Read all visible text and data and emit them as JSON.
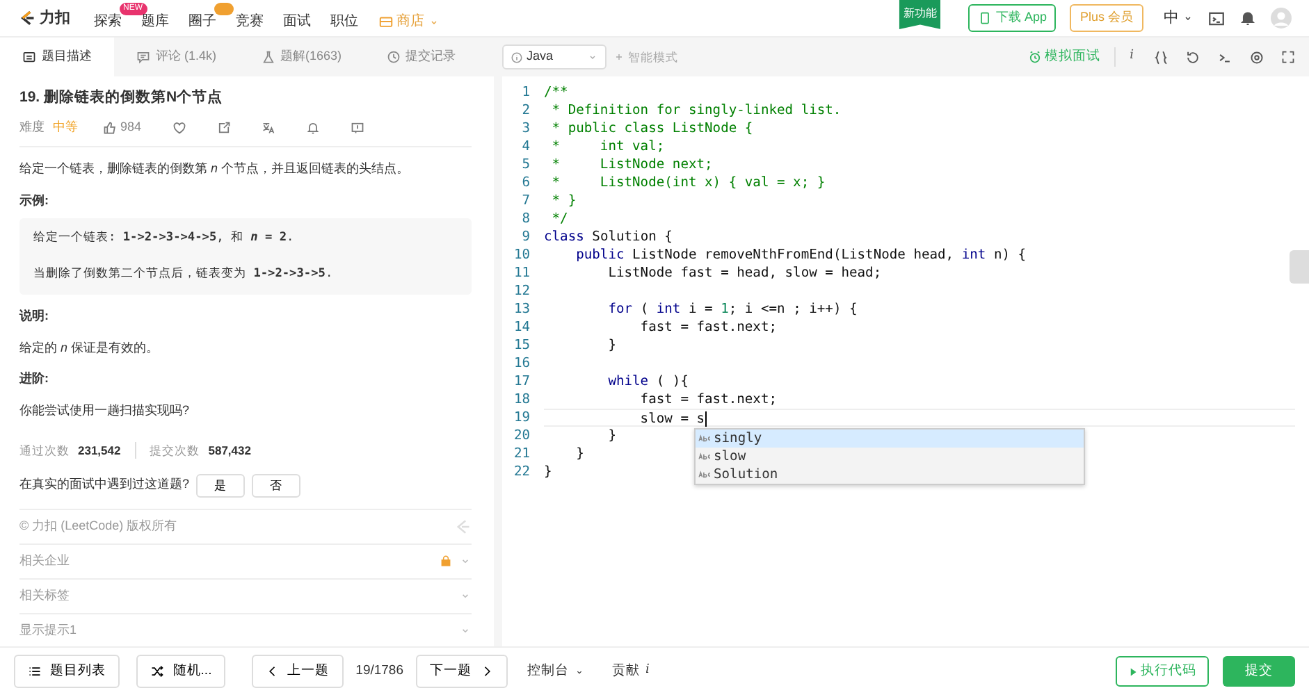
{
  "topnav": {
    "logo": "力扣",
    "items": [
      {
        "label": "探索",
        "kind": "link",
        "badge": {
          "text": "NEW",
          "color": "#e8336d"
        }
      },
      {
        "label": "题库",
        "kind": "link"
      },
      {
        "label": "圈子",
        "kind": "link",
        "badge": {
          "color": "#f0a030"
        }
      },
      {
        "label": "竞赛",
        "kind": "link"
      },
      {
        "label": "面试",
        "kind": "link"
      },
      {
        "label": "职位",
        "kind": "link"
      },
      {
        "label": "商店",
        "kind": "shop"
      }
    ],
    "ribbon": "新功能",
    "download": "下载 App",
    "plus": "Plus 会员",
    "language": "中"
  },
  "tabs": [
    {
      "label": "题目描述",
      "selected": true
    },
    {
      "label": "评论 (1.4k)",
      "selected": false
    },
    {
      "label": "题解(1663)",
      "selected": false
    },
    {
      "label": "提交记录",
      "selected": false
    }
  ],
  "editor_toolbar": {
    "language": "Java",
    "smart_mode": "智能模式",
    "mock_interview": "模拟面试",
    "info": "i"
  },
  "problem": {
    "title": "19. 删除链表的倒数第N个节点",
    "difficulty_label": "难度",
    "difficulty": "中等",
    "likes": "984",
    "description": "给定一个链表，删除链表的倒数第 *n* 个节点，并且返回链表的头结点。",
    "example_heading": "示例:",
    "example": [
      "给定一个链表: **1->2->3->4->5**, 和 ***n* = 2**.",
      "当删除了倒数第二个节点后，链表变为 **1->2->3->5**."
    ],
    "note_heading": "说明:",
    "note": "给定的 *n* 保证是有效的。",
    "advanced_heading": "进阶:",
    "advanced": "你能尝试使用一趟扫描实现吗?",
    "stats": [
      {
        "label": "通过次数",
        "value": "231,542"
      },
      {
        "label": "提交次数",
        "value": "587,432"
      }
    ],
    "interview_question": "在真实的面试中遇到过这道题?",
    "answers": [
      "是",
      "否"
    ],
    "copyright": "© 力扣 (LeetCode) 版权所有",
    "sections": [
      {
        "label": "相关企业",
        "locked": true
      },
      {
        "label": "相关标签",
        "locked": false
      },
      {
        "label": "显示提示1",
        "locked": false
      }
    ]
  },
  "code": [
    {
      "number": "1",
      "current": false,
      "tokens": [
        {
          "kind": "comment",
          "text": "/**"
        }
      ]
    },
    {
      "number": "2",
      "current": false,
      "tokens": [
        {
          "kind": "comment",
          "text": " * Definition for singly-linked list."
        }
      ]
    },
    {
      "number": "3",
      "current": false,
      "tokens": [
        {
          "kind": "comment",
          "text": " * public class ListNode {"
        }
      ]
    },
    {
      "number": "4",
      "current": false,
      "tokens": [
        {
          "kind": "comment",
          "text": " *     int val;"
        }
      ]
    },
    {
      "number": "5",
      "current": false,
      "tokens": [
        {
          "kind": "comment",
          "text": " *     ListNode next;"
        }
      ]
    },
    {
      "number": "6",
      "current": false,
      "tokens": [
        {
          "kind": "comment",
          "text": " *     ListNode(int x) { val = x; }"
        }
      ]
    },
    {
      "number": "7",
      "current": false,
      "tokens": [
        {
          "kind": "comment",
          "text": " * }"
        }
      ]
    },
    {
      "number": "8",
      "current": false,
      "tokens": [
        {
          "kind": "comment",
          "text": " */"
        }
      ]
    },
    {
      "number": "9",
      "current": false,
      "tokens": [
        {
          "kind": "keyword",
          "text": "class"
        },
        {
          "kind": "plain",
          "text": " Solution {"
        }
      ]
    },
    {
      "number": "10",
      "current": false,
      "tokens": [
        {
          "kind": "keyword",
          "text": "    public"
        },
        {
          "kind": "plain",
          "text": " ListNode removeNthFromEnd(ListNode head, "
        },
        {
          "kind": "keyword",
          "text": "int"
        },
        {
          "kind": "plain",
          "text": " n) {"
        }
      ]
    },
    {
      "number": "11",
      "current": false,
      "tokens": [
        {
          "kind": "plain",
          "text": "        ListNode fast = head, slow = head;"
        }
      ]
    },
    {
      "number": "12",
      "current": false
    },
    {
      "number": "13",
      "current": false,
      "tokens": [
        {
          "kind": "keyword",
          "text": "        for"
        },
        {
          "kind": "plain",
          "text": " ( "
        },
        {
          "kind": "keyword",
          "text": "int"
        },
        {
          "kind": "plain",
          "text": " i = "
        },
        {
          "kind": "number",
          "text": "1"
        },
        {
          "kind": "plain",
          "text": "; i <=n ; i++) {"
        }
      ]
    },
    {
      "number": "14",
      "current": false,
      "tokens": [
        {
          "kind": "plain",
          "text": "            fast = fast.next;"
        }
      ]
    },
    {
      "number": "15",
      "current": false,
      "tokens": [
        {
          "kind": "plain",
          "text": "        }"
        }
      ]
    },
    {
      "number": "16",
      "current": false
    },
    {
      "number": "17",
      "current": false,
      "tokens": [
        {
          "kind": "keyword",
          "text": "        while"
        },
        {
          "kind": "plain",
          "text": " ( ){"
        }
      ]
    },
    {
      "number": "18",
      "current": false,
      "tokens": [
        {
          "kind": "plain",
          "text": "            fast = fast.next;"
        }
      ]
    },
    {
      "number": "19",
      "current": true,
      "tokens": [
        {
          "kind": "plain",
          "text": "            slow = s"
        }
      ]
    },
    {
      "number": "20",
      "current": false,
      "tokens": [
        {
          "kind": "plain",
          "text": "        }"
        }
      ]
    },
    {
      "number": "21",
      "current": false,
      "tokens": [
        {
          "kind": "plain",
          "text": "    }"
        }
      ]
    },
    {
      "number": "22",
      "current": false,
      "tokens": [
        {
          "kind": "plain",
          "text": "}"
        }
      ]
    }
  ],
  "autocomplete": [
    {
      "label": "singly",
      "selected": true
    },
    {
      "label": "slow",
      "selected": false
    },
    {
      "label": "Solution",
      "selected": false
    }
  ],
  "footer": {
    "problem_list": "题目列表",
    "random": "随机...",
    "prev": "上一题",
    "position": "19/1786",
    "next": "下一题",
    "console": "控制台",
    "contribute": "贡献",
    "contribute_info": "i",
    "run": "执行代码",
    "submit": "提交"
  }
}
